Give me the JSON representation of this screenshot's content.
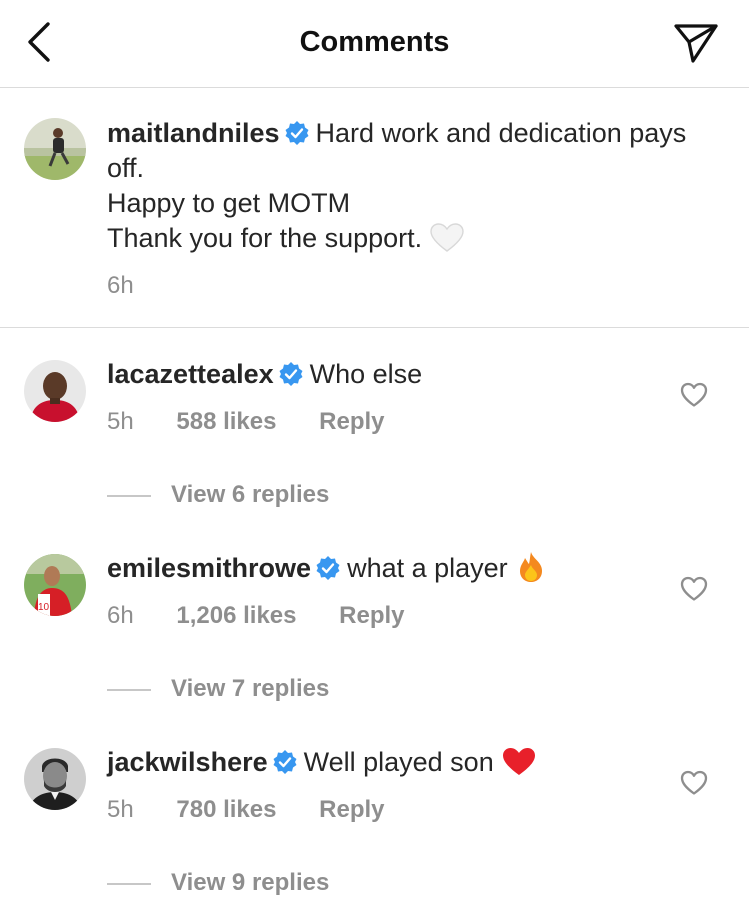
{
  "header": {
    "title": "Comments",
    "back_icon": "chevron-left-icon",
    "share_icon": "paper-plane-icon"
  },
  "caption": {
    "username": "maitlandniles",
    "line1": "Hard work and dedication pays off.",
    "line2": "Happy to get MOTM",
    "line3": "Thank you for the support.",
    "emoji": "white-heart-icon",
    "time": "6h"
  },
  "comments": [
    {
      "username": "lacazettealex",
      "text": "Who else",
      "time": "5h",
      "likes": "588 likes",
      "reply": "Reply",
      "view_replies": "View 6 replies"
    },
    {
      "username": "emilesmithrowe",
      "text": "what a player",
      "emoji": "fire-icon",
      "time": "6h",
      "likes": "1,206 likes",
      "reply": "Reply",
      "view_replies": "View 7 replies"
    },
    {
      "username": "jackwilshere",
      "text": "Well played son",
      "emoji": "red-heart-icon",
      "time": "5h",
      "likes": "780 likes",
      "reply": "Reply",
      "view_replies": "View 9 replies"
    }
  ],
  "colors": {
    "verified": "#3897f0",
    "secondary_text": "#8e8e8e",
    "divider": "#dbdbdb"
  }
}
